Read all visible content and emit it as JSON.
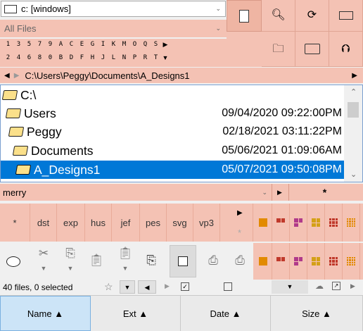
{
  "drive": {
    "value": "c: [windows]"
  },
  "filter": {
    "value": "All Files"
  },
  "charset": {
    "row1": [
      "1",
      "3",
      "5",
      "7",
      "9",
      "A",
      "C",
      "E",
      "G",
      "I",
      "K",
      "M",
      "O",
      "Q",
      "S"
    ],
    "row2": [
      "2",
      "4",
      "6",
      "8",
      "0",
      "B",
      "D",
      "F",
      "H",
      "J",
      "L",
      "N",
      "P",
      "R",
      "T"
    ]
  },
  "path": {
    "value": "C:\\Users\\Peggy\\Documents\\A_Designs1"
  },
  "tree": {
    "root": "C:\\",
    "items": [
      {
        "name": "Users",
        "date": "09/04/2020 09:22:00PM"
      },
      {
        "name": "Peggy",
        "date": "02/18/2021 03:11:22PM"
      },
      {
        "name": "Documents",
        "date": "05/06/2021 01:09:06AM"
      },
      {
        "name": "A_Designs1",
        "date": "05/07/2021 09:50:08PM"
      }
    ]
  },
  "search": {
    "value": "merry",
    "star": "*"
  },
  "extensions": [
    "*",
    "dst",
    "exp",
    "hus",
    "jef",
    "pes",
    "svg",
    "vp3"
  ],
  "ext_extra": "*",
  "status": {
    "text": "40 files, 0 selected"
  },
  "columns": [
    {
      "label": "Name ▲"
    },
    {
      "label": "Ext ▲"
    },
    {
      "label": "Date ▲"
    },
    {
      "label": "Size ▲"
    }
  ],
  "icons": {
    "colors": {
      "accent": "#0078d7",
      "toolbar": "#f4c2b4",
      "selected_col": "#cce4f7"
    }
  }
}
